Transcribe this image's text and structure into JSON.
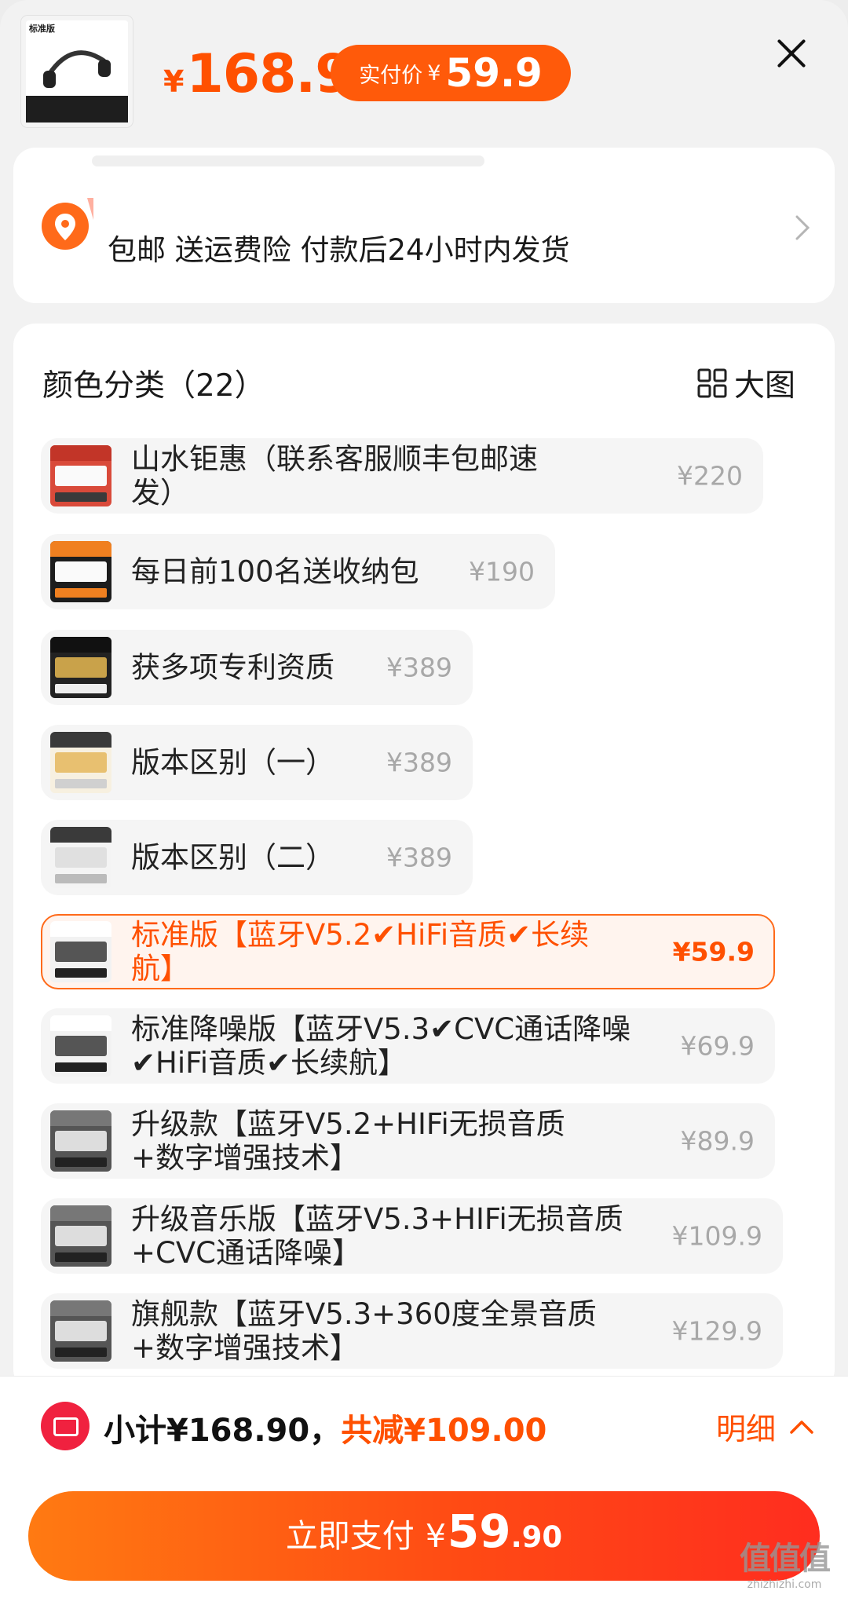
{
  "header": {
    "thumb_label": "标准版",
    "original_price_symbol": "¥",
    "original_price": "168.9",
    "pay_label": "实付价",
    "pay_symbol": "¥",
    "pay_amount": "59.9"
  },
  "shipping": {
    "text": "包邮 送运费险 付款后24小时内发货"
  },
  "sku_section": {
    "title": "颜色分类（22）",
    "big_pic_label": "大图",
    "items": [
      {
        "name": "山水钜惠（联系客服顺丰包邮速发）",
        "price": "¥220",
        "selected": false
      },
      {
        "name": "每日前100名送收纳包",
        "price": "¥190",
        "selected": false
      },
      {
        "name": "获多项专利资质",
        "price": "¥389",
        "selected": false
      },
      {
        "name": "版本区别（一）",
        "price": "¥389",
        "selected": false
      },
      {
        "name": "版本区别（二）",
        "price": "¥389",
        "selected": false
      },
      {
        "name": "标准版【蓝牙V5.2✔HiFi音质✔长续航】",
        "price": "¥59.9",
        "selected": true
      },
      {
        "name": "标准降噪版【蓝牙V5.3✔CVC通话降噪✔HiFi音质✔长续航】",
        "price": "¥69.9",
        "selected": false
      },
      {
        "name": "升级款【蓝牙V5.2+HIFi无损音质+数字增强技术】",
        "price": "¥89.9",
        "selected": false
      },
      {
        "name": "升级音乐版【蓝牙V5.3+HIFi无损音质+CVC通话降噪】",
        "price": "¥109.9",
        "selected": false
      },
      {
        "name": "旗舰款【蓝牙V5.3+360度全景音质+数字增强技术】",
        "price": "¥129.9",
        "selected": false
      }
    ]
  },
  "footer": {
    "subtotal": "小计¥168.90，",
    "discount": "共减¥109.00",
    "detail_label": "明细",
    "pay_label": "立即支付",
    "pay_symbol": "¥",
    "pay_int": "59",
    "pay_dec": ".90"
  },
  "watermark": {
    "big": "值值值",
    "small": "zhizhizhi.com"
  },
  "colors": {
    "accent": "#ff5000",
    "pay_button": "#ff4a14",
    "coupon": "#f0213f"
  }
}
